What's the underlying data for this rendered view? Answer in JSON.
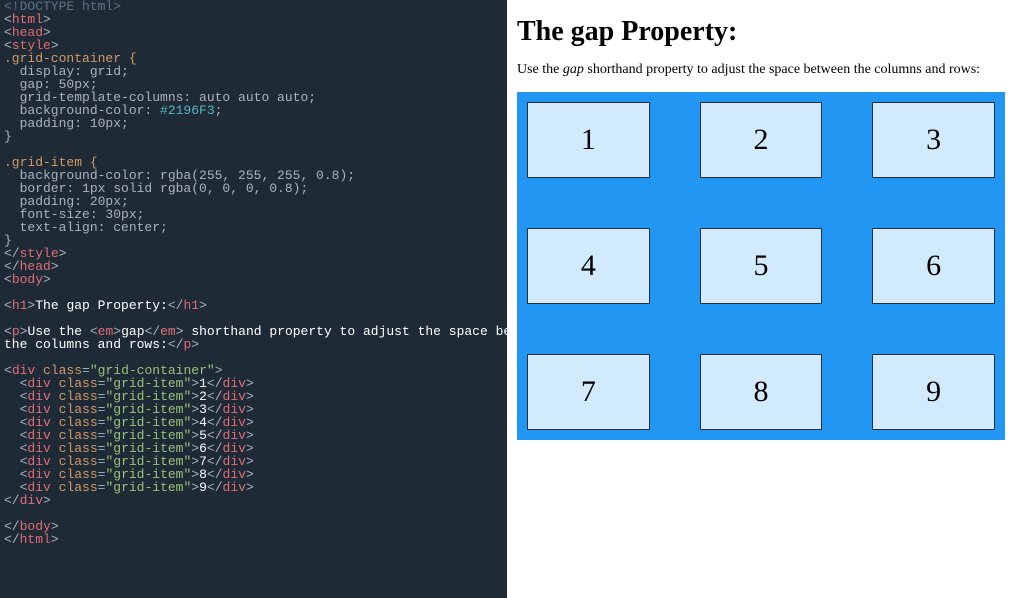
{
  "code": {
    "doctype": "<!DOCTYPE html>",
    "html_open": "html",
    "head_open": "head",
    "style_open": "style",
    "sel_container": ".grid-container {",
    "p_display": "  display: grid;",
    "p_gap": "  gap: 50px;",
    "p_cols": "  grid-template-columns: auto auto auto;",
    "p_bg": "  background-color: ",
    "p_bg_val": "#2196F3",
    "p_bg_end": ";",
    "p_pad": "  padding: 10px;",
    "brace_close1": "}",
    "sel_item": ".grid-item {",
    "p_itembg": "  background-color: rgba(255, 255, 255, 0.8);",
    "p_border": "  border: 1px solid rgba(0, 0, 0, 0.8);",
    "p_pad2": "  padding: 20px;",
    "p_fs": "  font-size: 30px;",
    "p_ta": "  text-align: center;",
    "brace_close2": "}",
    "style_close": "style",
    "head_close": "head",
    "body_open": "body",
    "h1_tag": "h1",
    "h1_text": "The gap Property:",
    "p_tag": "p",
    "p_text1": "Use the ",
    "em_tag": "em",
    "em_text": "gap",
    "p_text2": " shorthand property to adjust the space between",
    "p_text3": "the columns and rows:",
    "div_tag": "div",
    "class_attr": "class",
    "class_container": "\"grid-container\"",
    "class_item": "\"grid-item\"",
    "items": [
      "1",
      "2",
      "3",
      "4",
      "5",
      "6",
      "7",
      "8",
      "9"
    ],
    "body_close": "body",
    "html_close": "html"
  },
  "preview": {
    "heading": "The gap Property:",
    "para_pre": "Use the ",
    "para_em": "gap",
    "para_post": " shorthand property to adjust the space between the columns and rows:",
    "cells": [
      "1",
      "2",
      "3",
      "4",
      "5",
      "6",
      "7",
      "8",
      "9"
    ]
  }
}
